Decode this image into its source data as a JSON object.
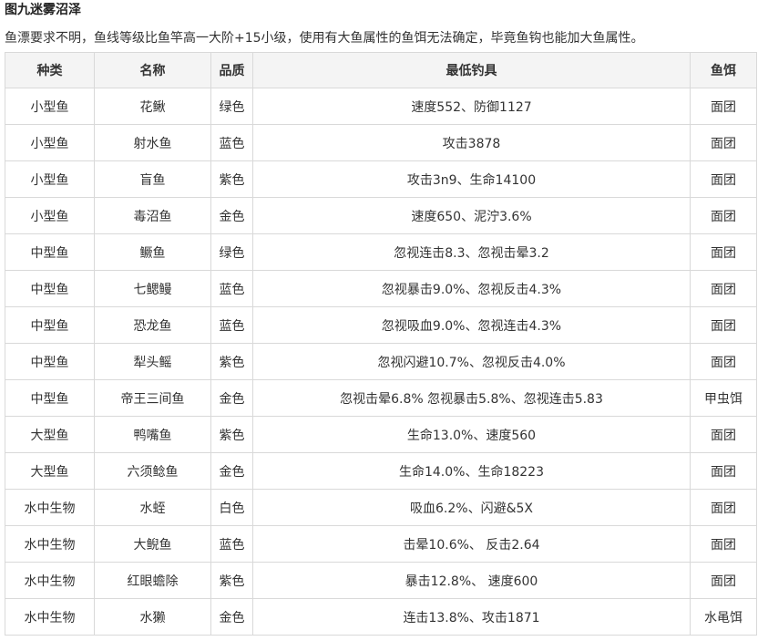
{
  "title": "图九迷雾沼泽",
  "intro": "鱼漂要求不明，鱼线等级比鱼竿高一大阶+15小级，使用有大鱼属性的鱼饵无法确定，毕竟鱼钩也能加大鱼属性。",
  "table": {
    "headers": [
      "种类",
      "名称",
      "品质",
      "最低钓具",
      "鱼饵"
    ],
    "rows": [
      [
        "小型鱼",
        "花鳅",
        "绿色",
        "速度552、防御1127",
        "面团"
      ],
      [
        "小型鱼",
        "射水鱼",
        "蓝色",
        "攻击3878",
        "面团"
      ],
      [
        "小型鱼",
        "盲鱼",
        "紫色",
        "攻击3n9、生命14100",
        "面团"
      ],
      [
        "小型鱼",
        "毒沼鱼",
        "金色",
        "速度650、泥泞3.6%",
        "面团"
      ],
      [
        "中型鱼",
        "鳜鱼",
        "绿色",
        "忽视连击8.3、忽视击晕3.2",
        "面团"
      ],
      [
        "中型鱼",
        "七鳃鳗",
        "蓝色",
        "忽视暴击9.0%、忽视反击4.3%",
        "面团"
      ],
      [
        "中型鱼",
        "恐龙鱼",
        "蓝色",
        "忽视吸血9.0%、忽视连击4.3%",
        "面团"
      ],
      [
        "中型鱼",
        "犁头鳐",
        "紫色",
        "忽视闪避10.7%、忽视反击4.0%",
        "面团"
      ],
      [
        "中型鱼",
        "帝王三间鱼",
        "金色",
        "忽视击晕6.8% 忽视暴击5.8%、忽视连击5.83",
        "甲虫饵"
      ],
      [
        "大型鱼",
        "鸭嘴鱼",
        "紫色",
        "生命13.0%、速度560",
        "面团"
      ],
      [
        "大型鱼",
        "六须鲶鱼",
        "金色",
        "生命14.0%、生命18223",
        "面团"
      ],
      [
        "水中生物",
        "水蛭",
        "白色",
        "吸血6.2%、闪避&5X",
        "面团"
      ],
      [
        "水中生物",
        "大鲵鱼",
        "蓝色",
        "击晕10.6%、 反击2.64",
        "面团"
      ],
      [
        "水中生物",
        "红眼蟾除",
        "紫色",
        "暴击12.8%、 速度600",
        "面团"
      ],
      [
        "水中生物",
        "水獭",
        "金色",
        "连击13.8%、攻击1871",
        "水黾饵"
      ]
    ]
  }
}
